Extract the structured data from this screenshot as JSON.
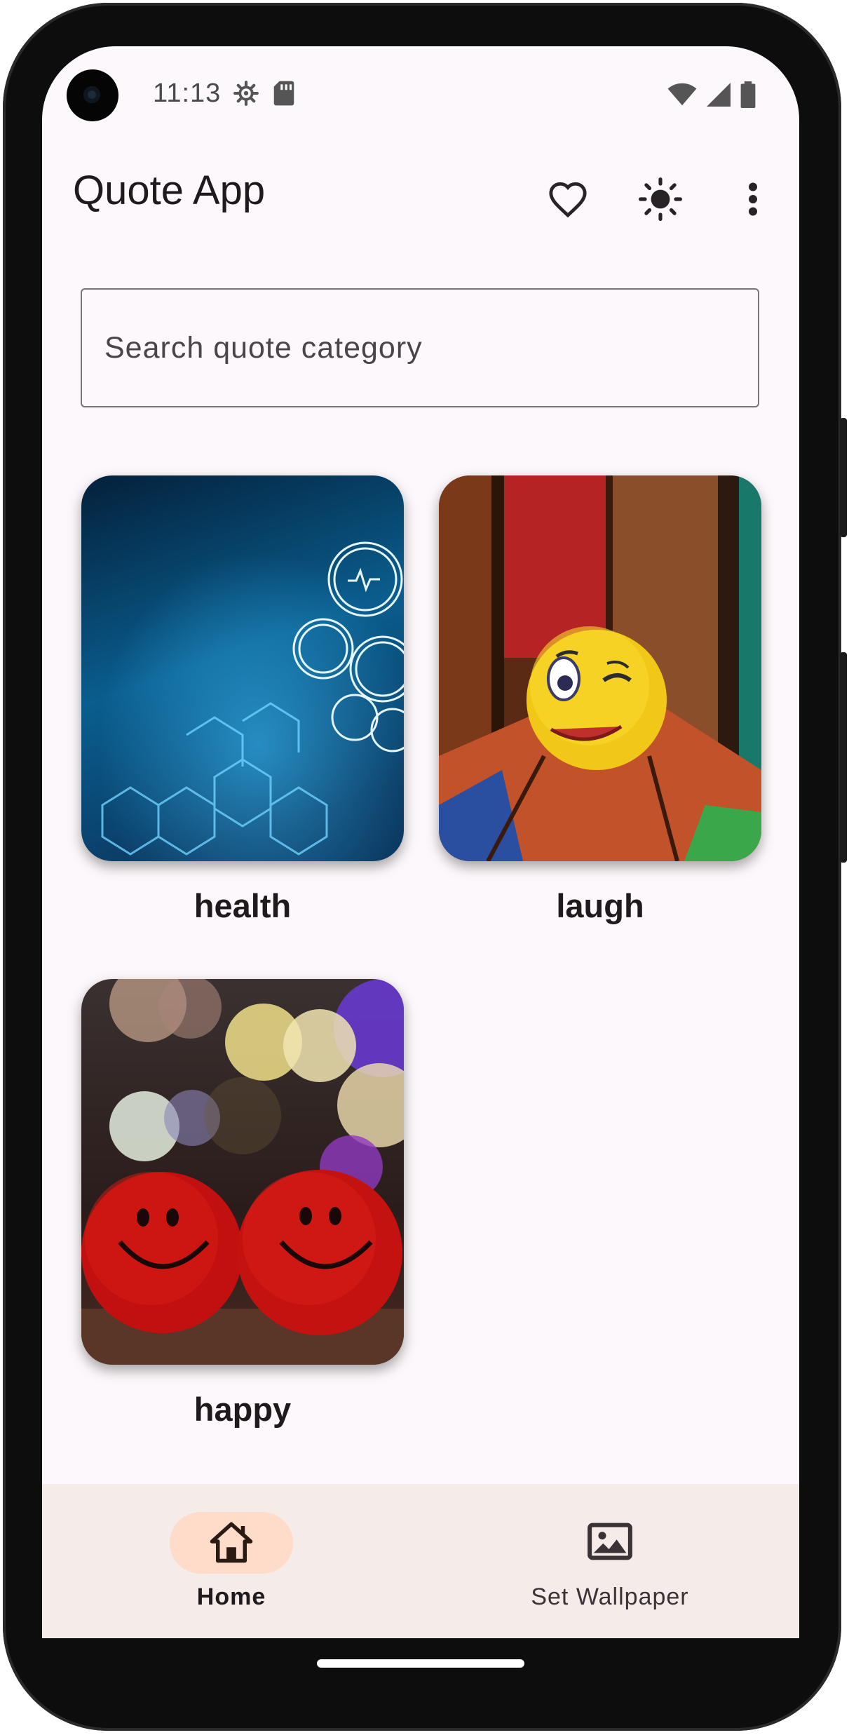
{
  "status_bar": {
    "time": "11:13"
  },
  "app_bar": {
    "title": "Quote App",
    "icons": [
      "heart-outline-icon",
      "brightness-icon",
      "more-vert-icon"
    ]
  },
  "search": {
    "placeholder": "Search quote category",
    "value": ""
  },
  "categories": [
    {
      "label": "health"
    },
    {
      "label": "laugh"
    },
    {
      "label": "happy"
    }
  ],
  "bottom_nav": {
    "items": [
      {
        "label": "Home",
        "icon": "home-icon",
        "selected": true
      },
      {
        "label": "Set Wallpaper",
        "icon": "image-icon",
        "selected": false
      }
    ]
  },
  "colors": {
    "background": "#fdf8fb",
    "nav_background": "#f5ecea",
    "nav_selected_pill": "#ffdbc9",
    "text_primary": "#1f1a1c"
  }
}
